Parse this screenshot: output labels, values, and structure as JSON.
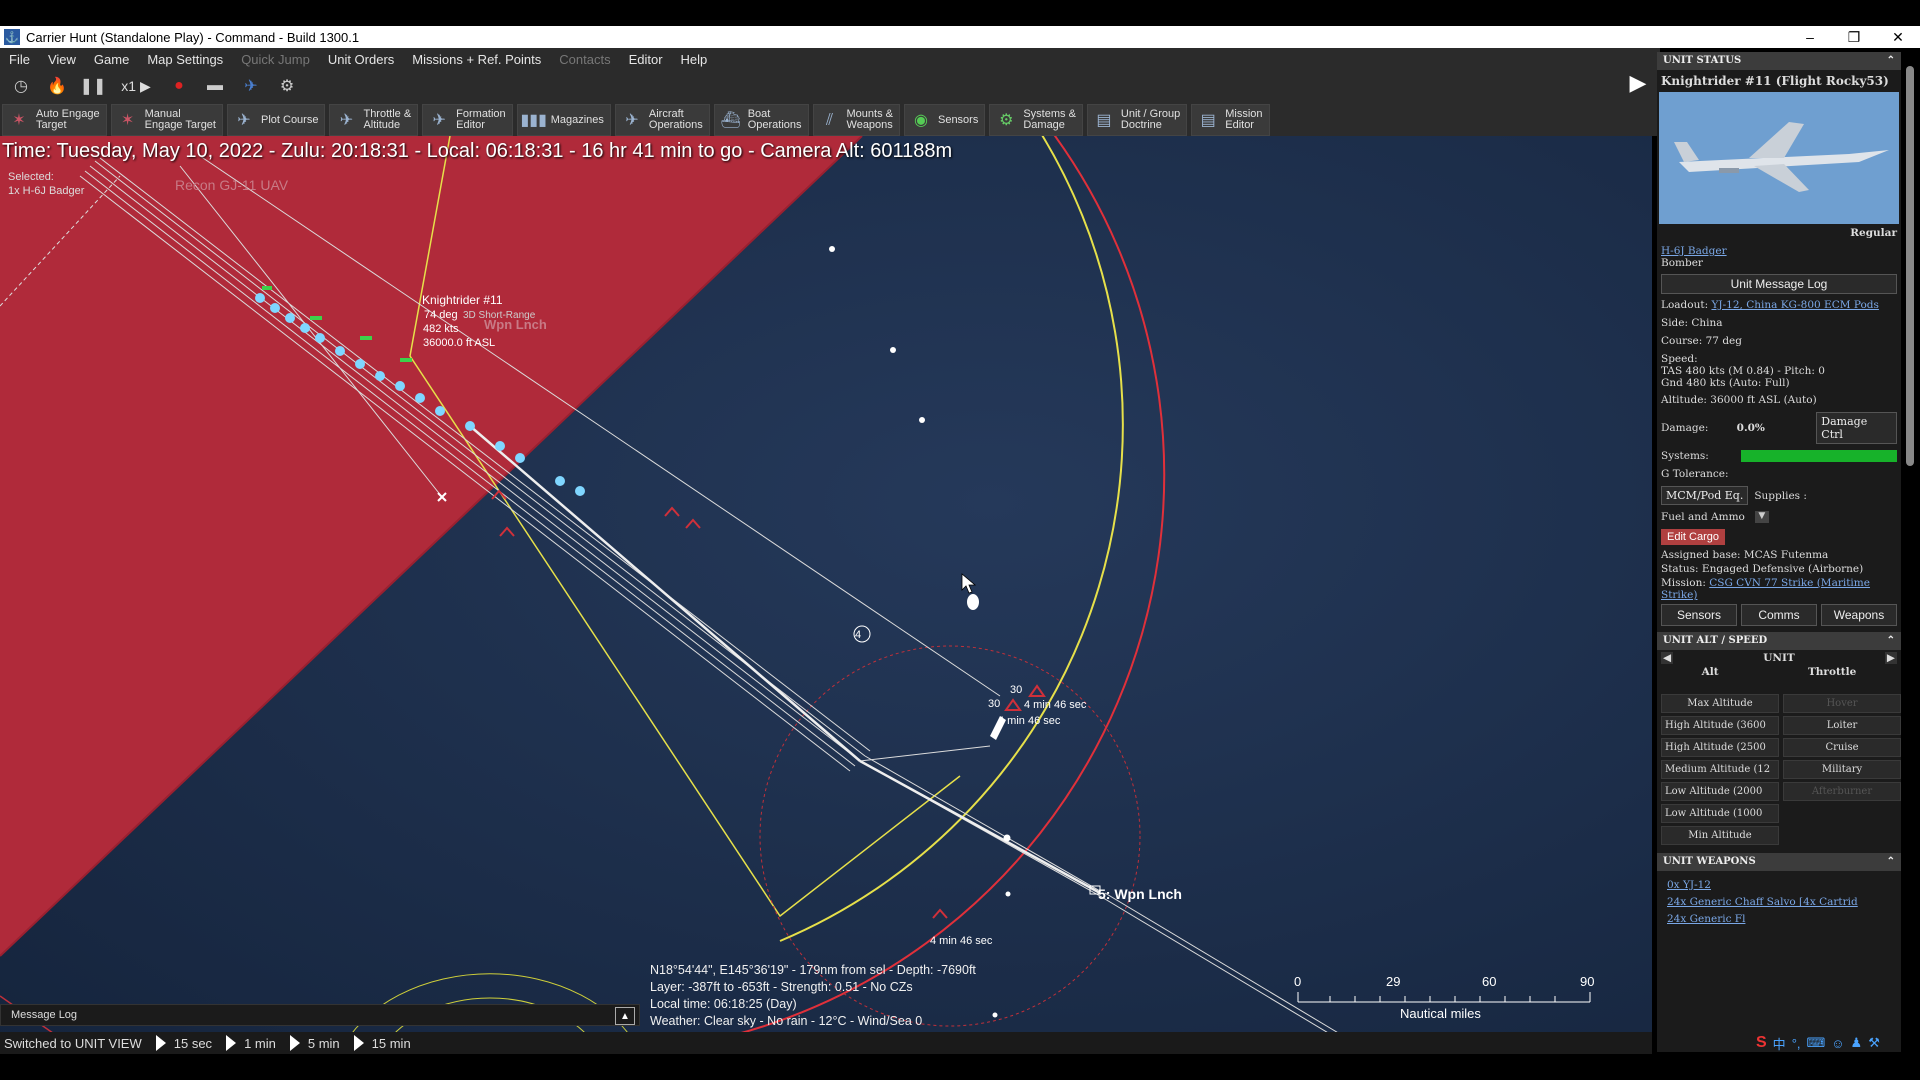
{
  "window": {
    "title": "Carrier Hunt (Standalone Play) - Command - Build 1300.1",
    "min": "–",
    "max": "❐",
    "close": "✕"
  },
  "menu": [
    "File",
    "View",
    "Game",
    "Map Settings",
    "Quick Jump",
    "Unit Orders",
    "Missions + Ref. Points",
    "Contacts",
    "Editor",
    "Help"
  ],
  "toolbar1": {
    "speed": "x1"
  },
  "toolbar2": [
    {
      "label": "Auto Engage\nTarget",
      "icon": "auto-engage-icon"
    },
    {
      "label": "Manual\nEngage Target",
      "icon": "manual-engage-icon"
    },
    {
      "label": "Plot Course",
      "icon": "plot-course-icon"
    },
    {
      "label": "Throttle &\nAltitude",
      "icon": "throttle-icon"
    },
    {
      "label": "Formation\nEditor",
      "icon": "formation-icon"
    },
    {
      "label": "Magazines",
      "icon": "magazines-icon"
    },
    {
      "label": "Aircraft\nOperations",
      "icon": "aircraft-icon"
    },
    {
      "label": "Boat\nOperations",
      "icon": "boat-icon"
    },
    {
      "label": "Mounts &\nWeapons",
      "icon": "weapons-icon"
    },
    {
      "label": "Sensors",
      "icon": "sensors-icon"
    },
    {
      "label": "Systems &\nDamage",
      "icon": "systems-icon"
    },
    {
      "label": "Unit / Group\nDoctrine",
      "icon": "doctrine-icon"
    },
    {
      "label": "Mission\nEditor",
      "icon": "mission-icon"
    }
  ],
  "map": {
    "time_line": "Time: Tuesday, May 10, 2022 - Zulu: 20:18:31 - Local: 06:18:31 - 16 hr 41 min to go -  Camera Alt: 601188m",
    "selected_label": "Selected:",
    "selected_unit": "1x H-6J Badger",
    "recon_label": "Recon GJ-11 UAV",
    "unit_label": {
      "name": "Knightrider #11",
      "course": "74 deg",
      "speed": "482 kts",
      "alt": "36000.0 ft ASL",
      "extra": "3D Short-Range"
    },
    "wpn_lnch_faded": "Wpn Lnch",
    "waypoint_5": "5: Wpn Lnch",
    "waypoint_4": "4",
    "eta_1": "4 min 46 sec",
    "eta_2": "4 min 46 sec",
    "eta_3": "4 min 46 sec",
    "num_30a": "30",
    "num_30b": "30",
    "cursor_info": [
      "N18°54'44\", E145°36'19\" - 179nm from sel - Depth: -7690ft",
      "Layer: -387ft to -653ft - Strength: 0.51 - No CZs",
      "Local time: 06:18:25 (Day)",
      "Weather: Clear sky - No rain - 12°C - Wind/Sea 0"
    ],
    "scale": {
      "ticks": [
        "0",
        "29",
        "60",
        "90"
      ],
      "unit": "Nautical miles"
    }
  },
  "message_log": "Message Log",
  "status": {
    "view": "Switched to UNIT VIEW",
    "steps": [
      "15 sec",
      "1 min",
      "5 min",
      "15 min"
    ]
  },
  "panel": {
    "unit_status_header": "UNIT STATUS",
    "unit_name": "Knightrider #11 (Flight Rocky53)",
    "proficiency": "Regular",
    "type_link": "H-6J Badger",
    "role": "Bomber",
    "msg_log_btn": "Unit Message Log",
    "loadout_label": "Loadout:",
    "loadout_value": "YJ-12, China KG-800 ECM Pods",
    "side": "Side: China",
    "course": "Course: 77 deg",
    "speed_label": "Speed:",
    "speed_tas": "TAS 480 kts (M 0.84) - Pitch: 0",
    "speed_gnd": "Gnd 480 kts (Auto: Full)",
    "altitude": "Altitude: 36000 ft ASL (Auto)",
    "damage_label": "Damage:",
    "damage_value": "0.0%",
    "damage_btn": "Damage Ctrl",
    "systems_label": "Systems:",
    "systems_fraction": 1.0,
    "g_tolerance": "G Tolerance:",
    "mcm_btn": "MCM/Pod Eq.",
    "supplies": "Supplies :",
    "fuel_ammo": "Fuel and Ammo",
    "edit_cargo": "Edit Cargo",
    "assigned_base": "Assigned base: MCAS Futenma",
    "status_line": "Status: Engaged Defensive (Airborne)",
    "mission_label": "Mission:",
    "mission_value": "CSG CVN 77 Strike (Maritime Strike)",
    "tabs": [
      "Sensors",
      "Comms",
      "Weapons"
    ],
    "alt_header": "UNIT ALT / SPEED",
    "alt_nav_title": "UNIT",
    "alt_col": "Alt",
    "throttle_col": "Throttle",
    "alt_rows": [
      [
        "Max Altitude",
        "Hover"
      ],
      [
        "High Altitude (3600",
        "Loiter"
      ],
      [
        "High Altitude (2500",
        "Cruise"
      ],
      [
        "Medium Altitude (12",
        "Military"
      ],
      [
        "Low Altitude (2000",
        "Afterburner"
      ],
      [
        "Low Altitude (1000",
        ""
      ],
      [
        "Min Altitude",
        ""
      ]
    ],
    "weapons_header": "UNIT WEAPONS",
    "weapons": [
      "0x YJ-12",
      "24x Generic Chaff Salvo [4x Cartrid",
      "24x Generic Fl"
    ]
  },
  "colors": {
    "hostile_zone": "#b02a3a",
    "ocean": "#1c2d48",
    "yellow": "#e6e04a",
    "red_line": "#e0303a",
    "accent_link": "#7aa7e6"
  }
}
